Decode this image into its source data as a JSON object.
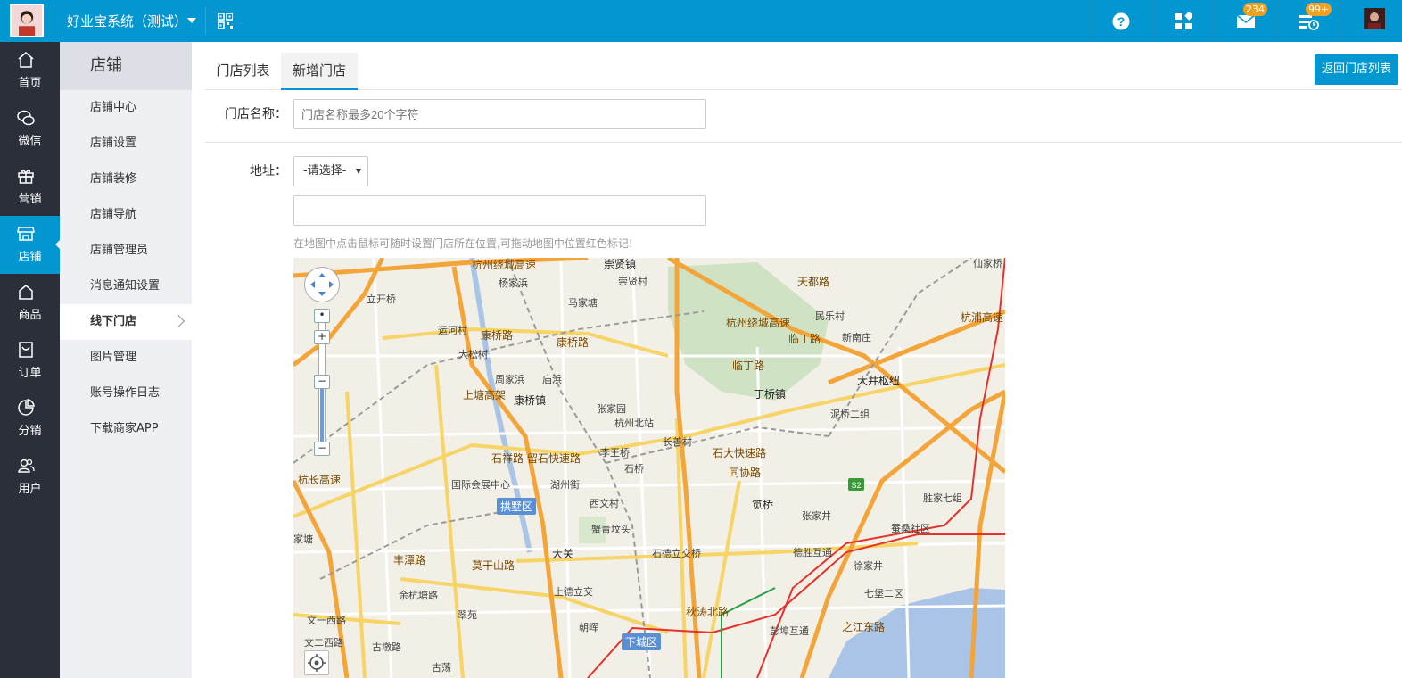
{
  "topbar": {
    "app_title": "好业宝系统（测试）",
    "icons": [
      "help-icon",
      "apps-icon",
      "mail-icon",
      "tasks-icon"
    ],
    "mail_badge": "234",
    "tasks_badge": "99+",
    "accent_color": "#0297d0"
  },
  "nav": {
    "items": [
      {
        "label": "首页",
        "icon": "home-icon"
      },
      {
        "label": "微信",
        "icon": "wechat-icon"
      },
      {
        "label": "营销",
        "icon": "gift-icon"
      },
      {
        "label": "店铺",
        "icon": "store-icon",
        "active": true
      },
      {
        "label": "商品",
        "icon": "goods-icon"
      },
      {
        "label": "订单",
        "icon": "order-icon"
      },
      {
        "label": "分销",
        "icon": "pie-icon"
      },
      {
        "label": "用户",
        "icon": "users-icon"
      }
    ]
  },
  "subnav": {
    "title": "店铺",
    "items": [
      {
        "label": "店铺中心"
      },
      {
        "label": "店铺设置"
      },
      {
        "label": "店铺装修"
      },
      {
        "label": "店铺导航"
      },
      {
        "label": "店铺管理员"
      },
      {
        "label": "消息通知设置"
      },
      {
        "label": "线下门店",
        "active": true
      },
      {
        "label": "图片管理"
      },
      {
        "label": "账号操作日志"
      },
      {
        "label": "下载商家APP"
      }
    ]
  },
  "tabs": [
    {
      "label": "门店列表"
    },
    {
      "label": "新增门店",
      "active": true
    }
  ],
  "back_button": "返回门店列表",
  "form": {
    "store_name_label": "门店名称：",
    "store_name_placeholder": "门店名称最多20个字符",
    "address_label": "地址：",
    "address_select": "-请选择-",
    "address_detail_value": "",
    "map_hint": "在地图中点击鼠标可随时设置门店所在位置,可拖动地图中位置红色标记!"
  },
  "map": {
    "labels": [
      "杭州绕城高速",
      "崇贤镇",
      "仙家桥",
      "杨家浜",
      "崇贤村",
      "立开桥",
      "马家塘",
      "天都路",
      "运河村",
      "康桥路",
      "康桥路",
      "杭州绕城高速",
      "民乐村",
      "临丁路",
      "新南庄",
      "大松树",
      "周家浜",
      "庙浜",
      "临丁路",
      "大井枢纽",
      "康桥镇",
      "丁桥镇",
      "张家园",
      "杭州北站",
      "泥桥二组",
      "上塘高架",
      "长善村",
      "石大快速路",
      "李王桥",
      "石祥路",
      "留石快速路",
      "石桥",
      "同协路",
      "国际会展中心",
      "湖州街",
      "拱墅区",
      "西文村",
      "笕桥",
      "张家井",
      "胜家七组",
      "蟹青坟头",
      "大关",
      "石德立交桥",
      "德胜互通",
      "蚕桑社区",
      "余杭塘路",
      "上德立交",
      "徐家井",
      "七堡二区",
      "翠苑",
      "朝晖",
      "彭埠互通",
      "文一西路",
      "文二西路",
      "古墩路",
      "下城区",
      "古荡",
      "之江东路",
      "家塘",
      "杭长高速",
      "杭浦高速",
      "丰潭路",
      "莫干山路",
      "秋涛北路"
    ]
  }
}
